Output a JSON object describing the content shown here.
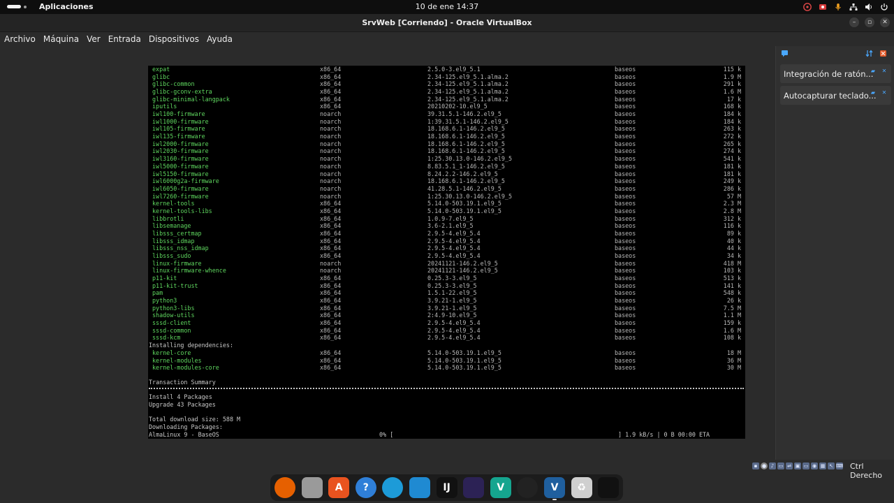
{
  "topbar": {
    "apps_label": "Aplicaciones",
    "clock": "10 de ene  14:37",
    "tray_icons": [
      "obs-tray-icon",
      "record-icon",
      "mic-icon",
      "network-icon",
      "volume-icon",
      "power-icon"
    ]
  },
  "window": {
    "title": "SrvWeb [Corriendo] - Oracle VirtualBox",
    "minimize": "–",
    "restore": "▫",
    "close": "✕"
  },
  "menubar": {
    "items": [
      "Archivo",
      "Máquina",
      "Ver",
      "Entrada",
      "Dispositivos",
      "Ayuda"
    ]
  },
  "side_panel": {
    "cards": [
      {
        "label": "Integración de ratón..."
      },
      {
        "label": "Autocapturar teclado..."
      }
    ]
  },
  "terminal": {
    "packages": [
      {
        "name": "expat",
        "arch": "x86_64",
        "version": "2.5.0-3.el9_5.1",
        "repo": "baseos",
        "size": "115 k"
      },
      {
        "name": "glibc",
        "arch": "x86_64",
        "version": "2.34-125.el9_5.1.alma.2",
        "repo": "baseos",
        "size": "1.9 M"
      },
      {
        "name": "glibc-common",
        "arch": "x86_64",
        "version": "2.34-125.el9_5.1.alma.2",
        "repo": "baseos",
        "size": "291 k"
      },
      {
        "name": "glibc-gconv-extra",
        "arch": "x86_64",
        "version": "2.34-125.el9_5.1.alma.2",
        "repo": "baseos",
        "size": "1.6 M"
      },
      {
        "name": "glibc-minimal-langpack",
        "arch": "x86_64",
        "version": "2.34-125.el9_5.1.alma.2",
        "repo": "baseos",
        "size": "17 k"
      },
      {
        "name": "iputils",
        "arch": "x86_64",
        "version": "20210202-10.el9_5",
        "repo": "baseos",
        "size": "168 k"
      },
      {
        "name": "iwl100-firmware",
        "arch": "noarch",
        "version": "39.31.5.1-146.2.el9_5",
        "repo": "baseos",
        "size": "184 k"
      },
      {
        "name": "iwl1000-firmware",
        "arch": "noarch",
        "version": "1:39.31.5.1-146.2.el9_5",
        "repo": "baseos",
        "size": "184 k"
      },
      {
        "name": "iwl105-firmware",
        "arch": "noarch",
        "version": "18.168.6.1-146.2.el9_5",
        "repo": "baseos",
        "size": "263 k"
      },
      {
        "name": "iwl135-firmware",
        "arch": "noarch",
        "version": "18.168.6.1-146.2.el9_5",
        "repo": "baseos",
        "size": "272 k"
      },
      {
        "name": "iwl2000-firmware",
        "arch": "noarch",
        "version": "18.168.6.1-146.2.el9_5",
        "repo": "baseos",
        "size": "265 k"
      },
      {
        "name": "iwl2030-firmware",
        "arch": "noarch",
        "version": "18.168.6.1-146.2.el9_5",
        "repo": "baseos",
        "size": "274 k"
      },
      {
        "name": "iwl3160-firmware",
        "arch": "noarch",
        "version": "1:25.30.13.0-146.2.el9_5",
        "repo": "baseos",
        "size": "541 k"
      },
      {
        "name": "iwl5000-firmware",
        "arch": "noarch",
        "version": "8.83.5.1_1-146.2.el9_5",
        "repo": "baseos",
        "size": "181 k"
      },
      {
        "name": "iwl5150-firmware",
        "arch": "noarch",
        "version": "8.24.2.2-146.2.el9_5",
        "repo": "baseos",
        "size": "181 k"
      },
      {
        "name": "iwl6000g2a-firmware",
        "arch": "noarch",
        "version": "18.168.6.1-146.2.el9_5",
        "repo": "baseos",
        "size": "249 k"
      },
      {
        "name": "iwl6050-firmware",
        "arch": "noarch",
        "version": "41.28.5.1-146.2.el9_5",
        "repo": "baseos",
        "size": "286 k"
      },
      {
        "name": "iwl7260-firmware",
        "arch": "noarch",
        "version": "1:25.30.13.0-146.2.el9_5",
        "repo": "baseos",
        "size": "57 M"
      },
      {
        "name": "kernel-tools",
        "arch": "x86_64",
        "version": "5.14.0-503.19.1.el9_5",
        "repo": "baseos",
        "size": "2.3 M"
      },
      {
        "name": "kernel-tools-libs",
        "arch": "x86_64",
        "version": "5.14.0-503.19.1.el9_5",
        "repo": "baseos",
        "size": "2.8 M"
      },
      {
        "name": "libbrotli",
        "arch": "x86_64",
        "version": "1.0.9-7.el9_5",
        "repo": "baseos",
        "size": "312 k"
      },
      {
        "name": "libsemanage",
        "arch": "x86_64",
        "version": "3.6-2.1.el9_5",
        "repo": "baseos",
        "size": "116 k"
      },
      {
        "name": "libsss_certmap",
        "arch": "x86_64",
        "version": "2.9.5-4.el9_5.4",
        "repo": "baseos",
        "size": "89 k"
      },
      {
        "name": "libsss_idmap",
        "arch": "x86_64",
        "version": "2.9.5-4.el9_5.4",
        "repo": "baseos",
        "size": "40 k"
      },
      {
        "name": "libsss_nss_idmap",
        "arch": "x86_64",
        "version": "2.9.5-4.el9_5.4",
        "repo": "baseos",
        "size": "44 k"
      },
      {
        "name": "libsss_sudo",
        "arch": "x86_64",
        "version": "2.9.5-4.el9_5.4",
        "repo": "baseos",
        "size": "34 k"
      },
      {
        "name": "linux-firmware",
        "arch": "noarch",
        "version": "20241121-146.2.el9_5",
        "repo": "baseos",
        "size": "418 M"
      },
      {
        "name": "linux-firmware-whence",
        "arch": "noarch",
        "version": "20241121-146.2.el9_5",
        "repo": "baseos",
        "size": "103 k"
      },
      {
        "name": "p11-kit",
        "arch": "x86_64",
        "version": "0.25.3-3.el9_5",
        "repo": "baseos",
        "size": "513 k"
      },
      {
        "name": "p11-kit-trust",
        "arch": "x86_64",
        "version": "0.25.3-3.el9_5",
        "repo": "baseos",
        "size": "141 k"
      },
      {
        "name": "pam",
        "arch": "x86_64",
        "version": "1.5.1-22.el9_5",
        "repo": "baseos",
        "size": "548 k"
      },
      {
        "name": "python3",
        "arch": "x86_64",
        "version": "3.9.21-1.el9_5",
        "repo": "baseos",
        "size": "26 k"
      },
      {
        "name": "python3-libs",
        "arch": "x86_64",
        "version": "3.9.21-1.el9_5",
        "repo": "baseos",
        "size": "7.5 M"
      },
      {
        "name": "shadow-utils",
        "arch": "x86_64",
        "version": "2:4.9-10.el9_5",
        "repo": "baseos",
        "size": "1.1 M"
      },
      {
        "name": "sssd-client",
        "arch": "x86_64",
        "version": "2.9.5-4.el9_5.4",
        "repo": "baseos",
        "size": "159 k"
      },
      {
        "name": "sssd-common",
        "arch": "x86_64",
        "version": "2.9.5-4.el9_5.4",
        "repo": "baseos",
        "size": "1.6 M"
      },
      {
        "name": "sssd-kcm",
        "arch": "x86_64",
        "version": "2.9.5-4.el9_5.4",
        "repo": "baseos",
        "size": "108 k"
      }
    ],
    "deps_heading": "Installing dependencies:",
    "dependencies": [
      {
        "name": "kernel-core",
        "arch": "x86_64",
        "version": "5.14.0-503.19.1.el9_5",
        "repo": "baseos",
        "size": "18 M"
      },
      {
        "name": "kernel-modules",
        "arch": "x86_64",
        "version": "5.14.0-503.19.1.el9_5",
        "repo": "baseos",
        "size": "36 M"
      },
      {
        "name": "kernel-modules-core",
        "arch": "x86_64",
        "version": "5.14.0-503.19.1.el9_5",
        "repo": "baseos",
        "size": "30 M"
      }
    ],
    "summary_heading": "Transaction Summary",
    "install_line": "Install    4 Packages",
    "upgrade_line": "Upgrade  43 Packages",
    "total_line": "Total download size: 588 M",
    "downloading_line": "Downloading Packages:",
    "progress_repo": "AlmaLinux 9 - BaseOS",
    "progress_pct": "0% [",
    "progress_rate": "] 1.9 kB/s |   0  B     00:00 ETA"
  },
  "statusbar": {
    "host_key": "Ctrl Derecho"
  },
  "dock": {
    "apps": [
      {
        "name": "firefox-icon",
        "glyph": "",
        "color": "#e66000"
      },
      {
        "name": "files-icon",
        "glyph": "",
        "color": "#9a9a9a"
      },
      {
        "name": "software-center-icon",
        "glyph": "A",
        "color": "#e9531f"
      },
      {
        "name": "help-icon",
        "glyph": "?",
        "color": "#2f7fd8"
      },
      {
        "name": "edge-icon",
        "glyph": "",
        "color": "#1d9bd8"
      },
      {
        "name": "vscode-icon",
        "glyph": "",
        "color": "#1f8ad2"
      },
      {
        "name": "intellij-icon",
        "glyph": "IJ",
        "color": "#111111"
      },
      {
        "name": "eclipse-icon",
        "glyph": "",
        "color": "#2c2255"
      },
      {
        "name": "veeam-icon",
        "glyph": "V",
        "color": "#15a58f"
      },
      {
        "name": "obs-icon",
        "glyph": "",
        "color": "#222222"
      },
      {
        "name": "virtualbox-icon",
        "glyph": "V",
        "color": "#1f5f9e"
      },
      {
        "name": "trash-icon",
        "glyph": "♻",
        "color": "#cfcfcf"
      },
      {
        "name": "app-grid-icon",
        "glyph": "",
        "color": "#111111"
      }
    ]
  }
}
